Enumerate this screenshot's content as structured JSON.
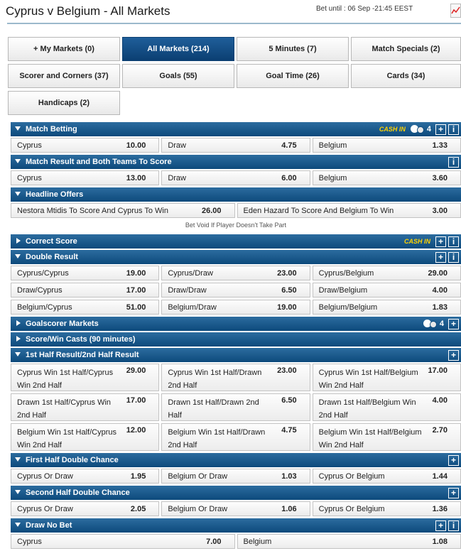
{
  "header": {
    "title": "Cyprus v Belgium - All Markets",
    "bet_until": "Bet until : 06 Sep -21:45 EEST"
  },
  "filters": [
    {
      "label": "+ My Markets (0)",
      "active": false
    },
    {
      "label": "All Markets (214)",
      "active": true
    },
    {
      "label": "5 Minutes (7)",
      "active": false
    },
    {
      "label": "Match Specials (2)",
      "active": false
    },
    {
      "label": "Scorer and Corners (37)",
      "active": false
    },
    {
      "label": "Goals (55)",
      "active": false
    },
    {
      "label": "Goal Time (26)",
      "active": false
    },
    {
      "label": "Cards (34)",
      "active": false
    },
    {
      "label": "Handicaps (2)",
      "active": false
    }
  ],
  "cash_in_label": "CASH IN",
  "markets": {
    "match_betting": {
      "title": "Match Betting",
      "inplay_count": "4",
      "rows": [
        [
          {
            "sel": "Cyprus",
            "odds": "10.00"
          },
          {
            "sel": "Draw",
            "odds": "4.75"
          },
          {
            "sel": "Belgium",
            "odds": "1.33"
          }
        ]
      ]
    },
    "result_btts": {
      "title": "Match Result and Both Teams To Score",
      "rows": [
        [
          {
            "sel": "Cyprus",
            "odds": "13.00"
          },
          {
            "sel": "Draw",
            "odds": "6.00"
          },
          {
            "sel": "Belgium",
            "odds": "3.60"
          }
        ]
      ]
    },
    "headline": {
      "title": "Headline Offers",
      "rows": [
        [
          {
            "sel": "Nestora Mtidis To Score And Cyprus To Win",
            "odds": "26.00"
          },
          {
            "sel": "Eden Hazard To Score And Belgium To Win",
            "odds": "3.00"
          }
        ]
      ],
      "note": "Bet Void If Player Doesn't Take Part"
    },
    "correct_score": {
      "title": "Correct Score"
    },
    "double_result": {
      "title": "Double Result",
      "rows": [
        [
          {
            "sel": "Cyprus/Cyprus",
            "odds": "19.00"
          },
          {
            "sel": "Cyprus/Draw",
            "odds": "23.00"
          },
          {
            "sel": "Cyprus/Belgium",
            "odds": "29.00"
          }
        ],
        [
          {
            "sel": "Draw/Cyprus",
            "odds": "17.00"
          },
          {
            "sel": "Draw/Draw",
            "odds": "6.50"
          },
          {
            "sel": "Draw/Belgium",
            "odds": "4.00"
          }
        ],
        [
          {
            "sel": "Belgium/Cyprus",
            "odds": "51.00"
          },
          {
            "sel": "Belgium/Draw",
            "odds": "19.00"
          },
          {
            "sel": "Belgium/Belgium",
            "odds": "1.83"
          }
        ]
      ]
    },
    "goalscorer": {
      "title": "Goalscorer Markets",
      "inplay_count": "4"
    },
    "score_win_casts": {
      "title": "Score/Win Casts (90 minutes)"
    },
    "half_result": {
      "title": "1st Half Result/2nd Half Result",
      "rows": [
        [
          {
            "sel": "Cyprus Win 1st Half/Cyprus Win 2nd Half",
            "odds": "29.00"
          },
          {
            "sel": "Cyprus Win 1st Half/Drawn 2nd Half",
            "odds": "23.00"
          },
          {
            "sel": "Cyprus Win 1st Half/Belgium Win 2nd Half",
            "odds": "17.00"
          }
        ],
        [
          {
            "sel": "Drawn 1st Half/Cyprus Win 2nd Half",
            "odds": "17.00"
          },
          {
            "sel": "Drawn 1st Half/Drawn 2nd Half",
            "odds": "6.50"
          },
          {
            "sel": "Drawn 1st Half/Belgium Win 2nd Half",
            "odds": "4.00"
          }
        ],
        [
          {
            "sel": "Belgium Win 1st Half/Cyprus Win 2nd Half",
            "odds": "12.00"
          },
          {
            "sel": "Belgium Win 1st Half/Drawn 2nd Half",
            "odds": "4.75"
          },
          {
            "sel": "Belgium Win 1st Half/Belgium Win 2nd Half",
            "odds": "2.70"
          }
        ]
      ]
    },
    "first_half_dc": {
      "title": "First Half Double Chance",
      "rows": [
        [
          {
            "sel": "Cyprus Or Draw",
            "odds": "1.95"
          },
          {
            "sel": "Belgium Or Draw",
            "odds": "1.03"
          },
          {
            "sel": "Cyprus Or Belgium",
            "odds": "1.44"
          }
        ]
      ]
    },
    "second_half_dc": {
      "title": "Second Half Double Chance",
      "rows": [
        [
          {
            "sel": "Cyprus Or Draw",
            "odds": "2.05"
          },
          {
            "sel": "Belgium Or Draw",
            "odds": "1.06"
          },
          {
            "sel": "Cyprus Or Belgium",
            "odds": "1.36"
          }
        ]
      ]
    },
    "draw_no_bet": {
      "title": "Draw No Bet",
      "rows": [
        [
          {
            "sel": "Cyprus",
            "odds": "7.00"
          },
          {
            "sel": "Belgium",
            "odds": "1.08"
          }
        ]
      ]
    }
  }
}
